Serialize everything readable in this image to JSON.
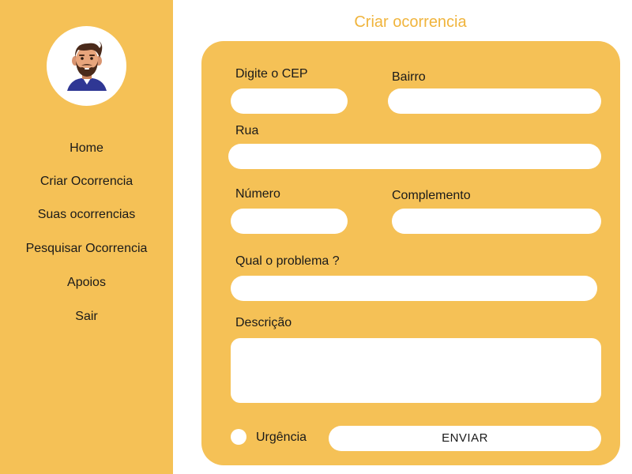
{
  "sidebar": {
    "nav": [
      {
        "label": "Home"
      },
      {
        "label": "Criar Ocorrencia"
      },
      {
        "label": "Suas ocorrencias"
      },
      {
        "label": "Pesquisar Ocorrencia"
      },
      {
        "label": "Apoios"
      },
      {
        "label": "Sair"
      }
    ]
  },
  "page": {
    "title": "Criar ocorrencia"
  },
  "form": {
    "cep": {
      "label": "Digite o CEP",
      "value": ""
    },
    "bairro": {
      "label": "Bairro",
      "value": ""
    },
    "rua": {
      "label": "Rua",
      "value": ""
    },
    "numero": {
      "label": "Número",
      "value": ""
    },
    "complemento": {
      "label": "Complemento",
      "value": ""
    },
    "problema": {
      "label": "Qual o problema ?",
      "value": ""
    },
    "descricao": {
      "label": "Descrição",
      "value": ""
    },
    "urgencia": {
      "label": "Urgência",
      "checked": false
    },
    "submit_label": "ENVIAR"
  },
  "colors": {
    "accent": "#f5c156",
    "title": "#f0b43c",
    "field": "#ffffff"
  }
}
